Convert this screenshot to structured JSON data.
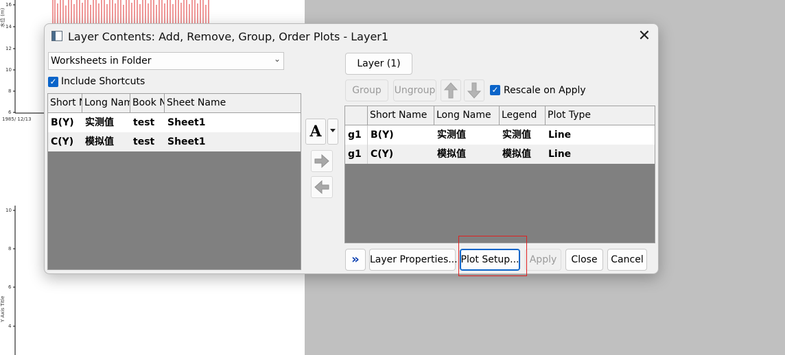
{
  "background": {
    "y_ticks_top": [
      "16",
      "14",
      "12",
      "10",
      "8",
      "6"
    ],
    "y_ticks_bottom": [
      "10",
      "8",
      "6",
      "4"
    ],
    "axis_title_top": "水位 (m)",
    "axis_title_bottom": "Y Axis Title",
    "x_tick": "1985/ 12/13"
  },
  "dialog": {
    "title": "Layer Contents: Add, Remove, Group, Order Plots - Layer1",
    "close_glyph": "✕",
    "source_combo": "Worksheets in Folder",
    "include_shortcuts": "Include Shortcuts",
    "left_headers": [
      "Short N",
      "Long Nam",
      "Book N",
      "Sheet Name"
    ],
    "left_rows": [
      [
        "B(Y)",
        "实测值",
        "test",
        "Sheet1"
      ],
      [
        "C(Y)",
        "模拟值",
        "test",
        "Sheet1"
      ]
    ],
    "font_glyph": "A",
    "layer_button": "Layer (1)",
    "group_button": "Group",
    "ungroup_button": "Ungroup",
    "rescale_label": "Rescale on Apply",
    "right_headers": [
      "",
      "Short Name",
      "Long Name",
      "Legend",
      "Plot Type"
    ],
    "right_rows": [
      [
        "g1",
        "B(Y)",
        "实测值",
        "实测值",
        "Line"
      ],
      [
        "g1",
        "C(Y)",
        "模拟值",
        "模拟值",
        "Line"
      ]
    ],
    "expand_glyph": "»",
    "layer_properties_button": "Layer Properties...",
    "plot_setup_button": "Plot Setup...",
    "apply_button": "Apply",
    "close_button": "Close",
    "cancel_button": "Cancel"
  },
  "colors": {
    "accent": "#0a64c9",
    "highlight": "#e02020",
    "plot_line": "#e03030"
  }
}
